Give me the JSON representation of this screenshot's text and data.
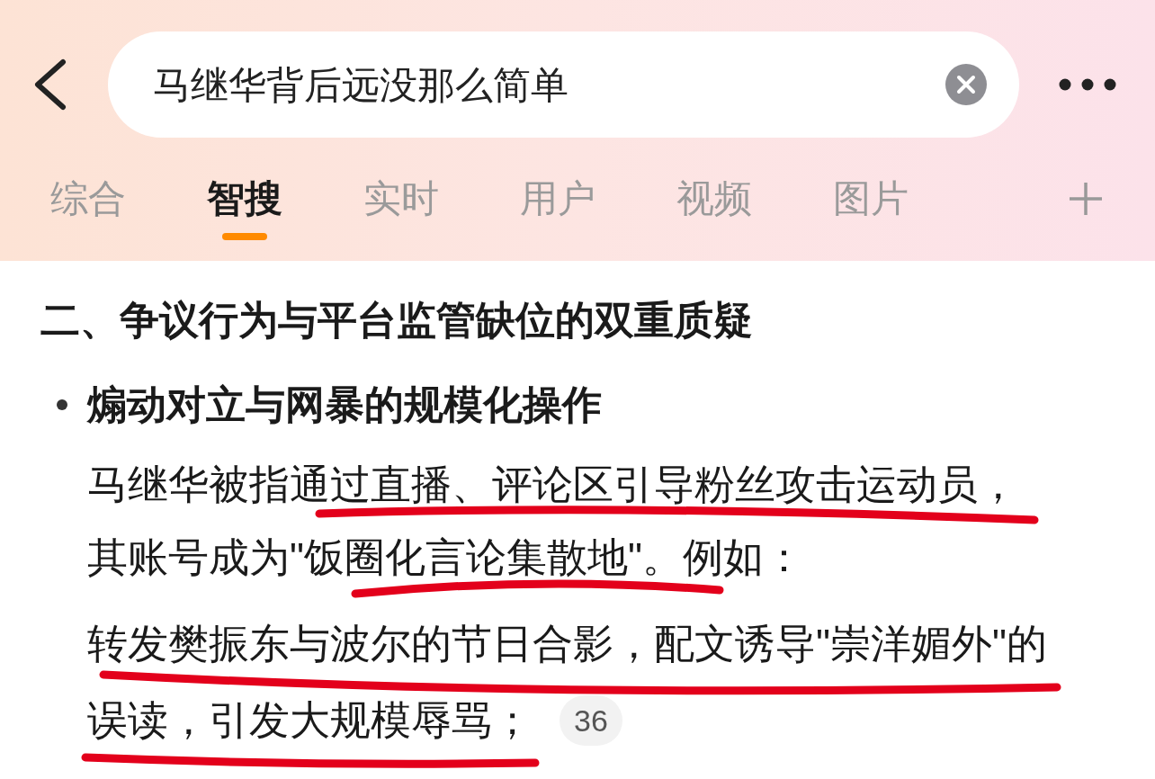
{
  "search": {
    "query": "马继华背后远没那么简单"
  },
  "tabs": [
    {
      "label": "综合",
      "selected": false
    },
    {
      "label": "智搜",
      "selected": true
    },
    {
      "label": "实时",
      "selected": false
    },
    {
      "label": "用户",
      "selected": false
    },
    {
      "label": "视频",
      "selected": false
    },
    {
      "label": "图片",
      "selected": false
    }
  ],
  "article": {
    "heading": "二、争议行为与平台监管缺位的双重质疑",
    "bullet": {
      "title": "煽动对立与网暴的规模化操作",
      "paragraphs": [
        {
          "lines": [
            "马继华被指通过直播、评论区引导粉丝攻击运动员，",
            "其账号成为\"饭圈化言论集散地\"。例如："
          ]
        },
        {
          "lines": [
            "转发樊振东与波尔的节日合影，配文诱导\"崇洋媚外\"的",
            "误读，引发大规模辱骂；"
          ]
        }
      ],
      "badge": "36"
    }
  }
}
